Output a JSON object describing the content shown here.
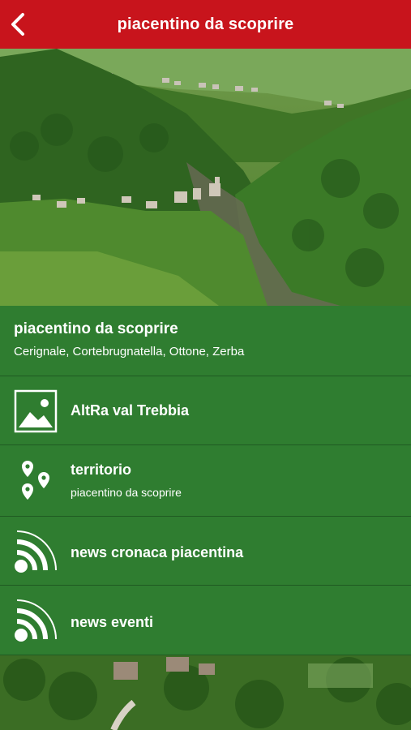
{
  "header": {
    "title": "piacentino da scoprire",
    "back_icon": "chevron-left-icon",
    "color": "#c8141c"
  },
  "info": {
    "title": "piacentino da scoprire",
    "subtitle": "Cerignale, Cortebrugnatella, Ottone, Zerba"
  },
  "menu": [
    {
      "label": "AltRa val Trebbia",
      "icon": "image-icon"
    },
    {
      "label": "territorio",
      "sublabel": "piacentino da scoprire",
      "icon": "map-pins-icon"
    },
    {
      "label": "news cronaca piacentina",
      "icon": "rss-icon"
    },
    {
      "label": "news eventi",
      "icon": "rss-icon"
    }
  ],
  "colors": {
    "menu_green": "#2f7d30",
    "divider": "#1f5a22"
  }
}
